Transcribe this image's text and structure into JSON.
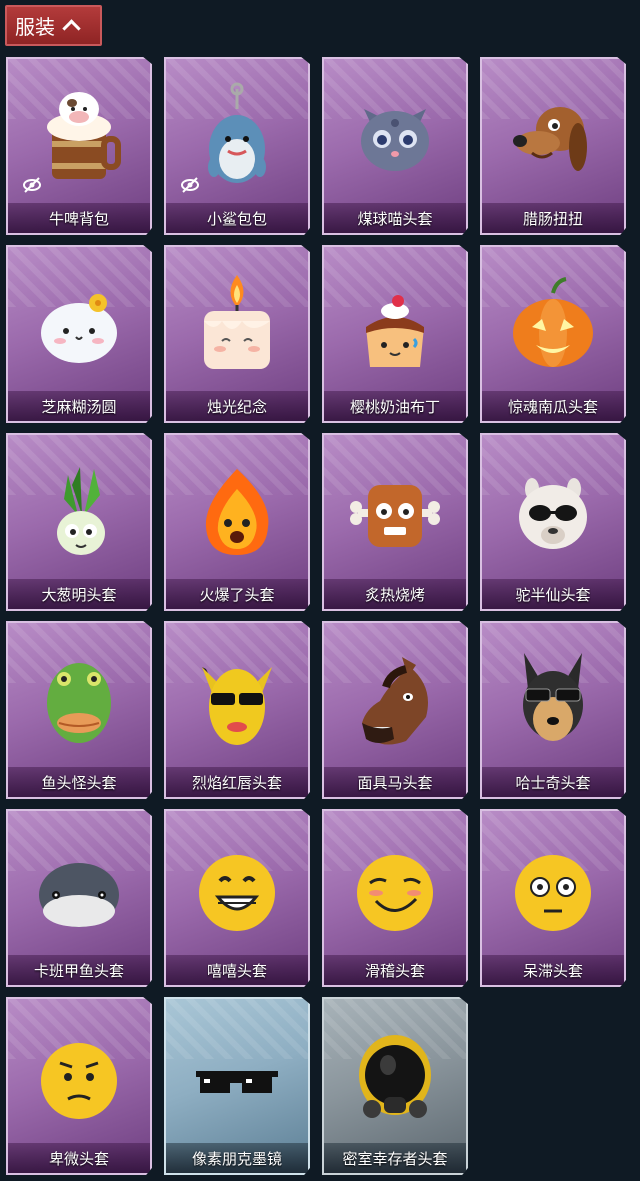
{
  "header": {
    "title": "服装"
  },
  "items": [
    {
      "label": "牛啤背包",
      "icon": "beer-mug-cow-icon",
      "hidden": true,
      "theme": "purple"
    },
    {
      "label": "小鲨包包",
      "icon": "shark-backpack-icon",
      "hidden": true,
      "theme": "purple"
    },
    {
      "label": "煤球喵头套",
      "icon": "grey-cat-head-icon",
      "hidden": false,
      "theme": "purple"
    },
    {
      "label": "腊肠扭扭",
      "icon": "dachshund-head-icon",
      "hidden": false,
      "theme": "purple"
    },
    {
      "label": "芝麻糊汤圆",
      "icon": "rice-ball-icon",
      "hidden": false,
      "theme": "purple"
    },
    {
      "label": "烛光纪念",
      "icon": "candle-head-icon",
      "hidden": false,
      "theme": "purple"
    },
    {
      "label": "樱桃奶油布丁",
      "icon": "cherry-pudding-icon",
      "hidden": false,
      "theme": "purple"
    },
    {
      "label": "惊魂南瓜头套",
      "icon": "pumpkin-head-icon",
      "hidden": false,
      "theme": "purple"
    },
    {
      "label": "大葱明头套",
      "icon": "scallion-head-icon",
      "hidden": false,
      "theme": "purple"
    },
    {
      "label": "火爆了头套",
      "icon": "flame-head-icon",
      "hidden": false,
      "theme": "purple"
    },
    {
      "label": "炙热烧烤",
      "icon": "bbq-meat-head-icon",
      "hidden": false,
      "theme": "purple"
    },
    {
      "label": "驼半仙头套",
      "icon": "alpaca-sunglasses-head-icon",
      "hidden": false,
      "theme": "purple"
    },
    {
      "label": "鱼头怪头套",
      "icon": "fish-head-icon",
      "hidden": false,
      "theme": "purple"
    },
    {
      "label": "烈焰红唇头套",
      "icon": "yellow-mask-head-icon",
      "hidden": false,
      "theme": "purple"
    },
    {
      "label": "面具马头套",
      "icon": "horse-head-icon",
      "hidden": false,
      "theme": "purple"
    },
    {
      "label": "哈士奇头套",
      "icon": "husky-head-icon",
      "hidden": false,
      "theme": "purple"
    },
    {
      "label": "卡班甲鱼头套",
      "icon": "turtle-head-icon",
      "hidden": false,
      "theme": "purple"
    },
    {
      "label": "嘻嘻头套",
      "icon": "grin-emoji-head-icon",
      "hidden": false,
      "theme": "purple"
    },
    {
      "label": "滑稽头套",
      "icon": "funny-emoji-head-icon",
      "hidden": false,
      "theme": "purple"
    },
    {
      "label": "呆滞头套",
      "icon": "dazed-emoji-head-icon",
      "hidden": false,
      "theme": "purple"
    },
    {
      "label": "卑微头套",
      "icon": "humble-emoji-head-icon",
      "hidden": false,
      "theme": "purple"
    },
    {
      "label": "像素朋克墨镜",
      "icon": "pixel-sunglasses-icon",
      "hidden": false,
      "theme": "blue"
    },
    {
      "label": "密室幸存者头套",
      "icon": "gas-mask-helmet-icon",
      "hidden": false,
      "theme": "grey"
    }
  ]
}
